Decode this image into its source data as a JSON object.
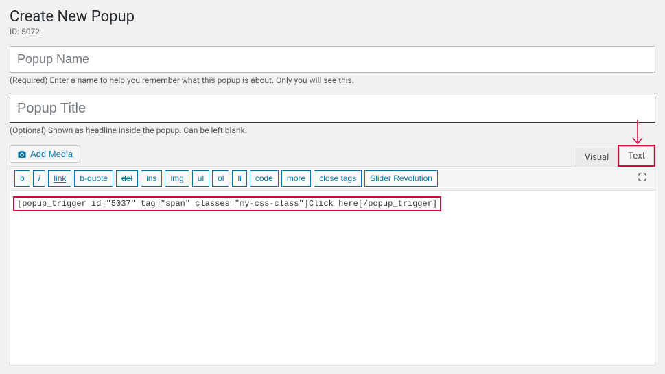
{
  "heading": "Create New Popup",
  "id_label": "ID: 5072",
  "name_placeholder": "Popup Name",
  "name_helper": "(Required) Enter a name to help you remember what this popup is about. Only you will see this.",
  "title_placeholder": "Popup Title",
  "title_helper": "(Optional) Shown as headline inside the popup. Can be left blank.",
  "add_media": "Add Media",
  "tabs": {
    "visual": "Visual",
    "text": "Text"
  },
  "toolbar": {
    "b": "b",
    "i": "i",
    "link": "link",
    "bquote": "b-quote",
    "del": "del",
    "ins": "ins",
    "img": "img",
    "ul": "ul",
    "ol": "ol",
    "li": "li",
    "code": "code",
    "more": "more",
    "close": "close tags",
    "slider": "Slider Revolution"
  },
  "content": "[popup_trigger id=\"5037\" tag=\"span\" classes=\"my-css-class\"]Click here[/popup_trigger]"
}
